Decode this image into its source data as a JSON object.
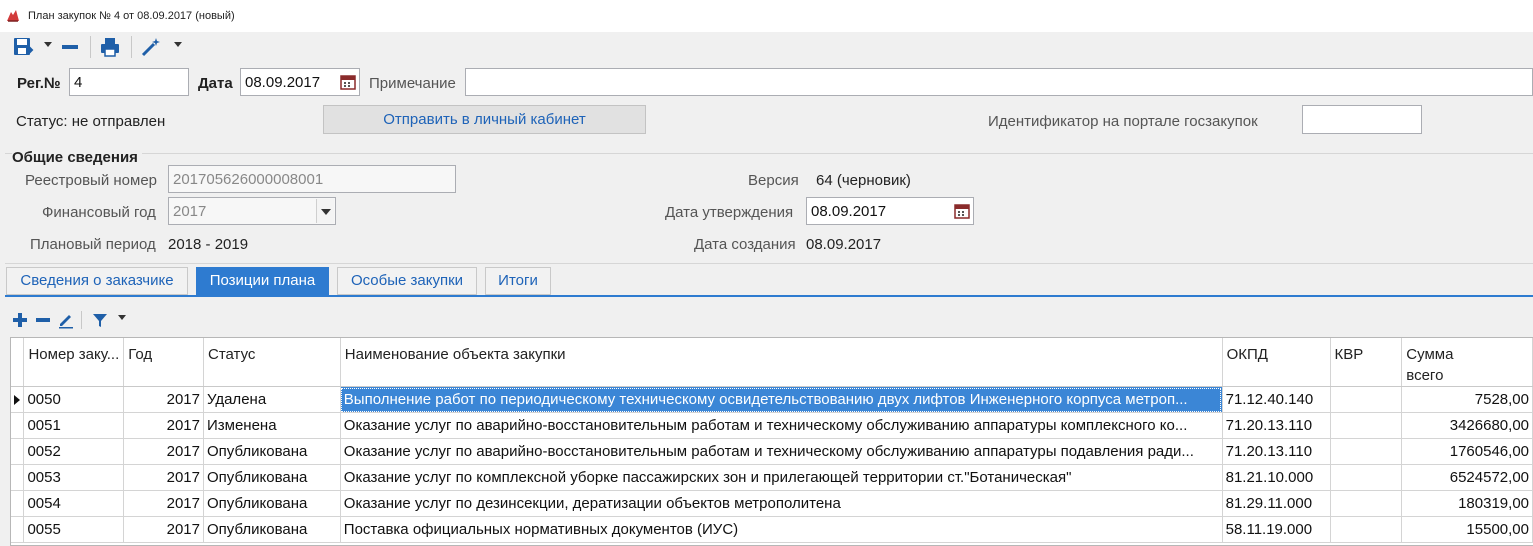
{
  "window": {
    "title": "План закупок № 4 от 08.09.2017 (новый)"
  },
  "toolbar": {
    "icons": [
      "save-icon",
      "dropdown-caret",
      "minus-icon",
      "print-icon",
      "magic-wand-icon",
      "dropdown-caret"
    ]
  },
  "header": {
    "reg_label": "Рег.№",
    "reg_value": "4",
    "date_label": "Дата",
    "date_value": "08.09.2017",
    "note_label": "Примечание",
    "note_value": "",
    "status_text": "Статус: не отправлен",
    "send_button": "Отправить в личный кабинет",
    "portal_id_label": "Идентификатор на портале госзакупок",
    "portal_id_value": ""
  },
  "general": {
    "section_title": "Общие сведения",
    "registry_label": "Реестровый номер",
    "registry_value": "201705626000008001",
    "fin_year_label": "Финансовый год",
    "fin_year_value": "2017",
    "period_label": "Плановый период",
    "period_value": "2018 - 2019",
    "version_label": "Версия",
    "version_value": "64 (черновик)",
    "approval_label": "Дата утверждения",
    "approval_value": "08.09.2017",
    "created_label": "Дата создания",
    "created_value": "08.09.2017"
  },
  "tabs": [
    {
      "label": "Сведения о заказчике",
      "active": false
    },
    {
      "label": "Позиции плана",
      "active": true
    },
    {
      "label": "Особые закупки",
      "active": false
    },
    {
      "label": "Итоги",
      "active": false
    }
  ],
  "grid_toolbar": {
    "icons": [
      "add-icon",
      "remove-icon",
      "edit-icon",
      "filter-icon",
      "dropdown-caret"
    ]
  },
  "grid": {
    "columns": [
      "Номер заку...",
      "Год",
      "Статус",
      "Наименование объекта закупки",
      "ОКПД",
      "КВР",
      "Сумма\nвсего"
    ],
    "rows": [
      [
        "0050",
        "2017",
        "Удалена",
        "Выполнение работ по периодическому техническому освидетельствованию двух лифтов Инженерного корпуса метроп...",
        "71.12.40.140",
        "",
        "7528,00"
      ],
      [
        "0051",
        "2017",
        "Изменена",
        "Оказание услуг по аварийно-восстановительным работам и техническому обслуживанию аппаратуры комплексного ко...",
        "71.20.13.110",
        "",
        "3426680,00"
      ],
      [
        "0052",
        "2017",
        "Опубликована",
        "Оказание услуг по аварийно-восстановительным работам и техническому обслуживанию аппаратуры подавления ради...",
        "71.20.13.110",
        "",
        "1760546,00"
      ],
      [
        "0053",
        "2017",
        "Опубликована",
        "Оказание услуг по комплексной уборке пассажирских зон и прилегающей территории ст.\"Ботаническая\"",
        "81.21.10.000",
        "",
        "6524572,00"
      ],
      [
        "0054",
        "2017",
        "Опубликована",
        "Оказание услуг по дезинсекции, дератизации объектов метрополитена",
        "81.29.11.000",
        "",
        "180319,00"
      ],
      [
        "0055",
        "2017",
        "Опубликована",
        "Поставка официальных нормативных документов (ИУС)",
        "58.11.19.000",
        "",
        "15500,00"
      ]
    ]
  },
  "colors": {
    "accent": "#2e7bd0",
    "link": "#1e63b8",
    "selection": "#3b86d6"
  }
}
